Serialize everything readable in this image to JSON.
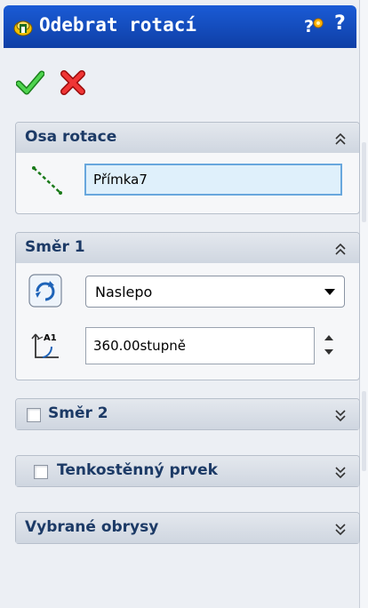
{
  "window": {
    "title": "Odebrat rotací",
    "help_label": "?"
  },
  "actions": {
    "ok": "confirm-check-icon",
    "cancel": "cancel-x-icon"
  },
  "axis_group": {
    "title": "Osa rotace",
    "entity_value": "Přímka7"
  },
  "direction1": {
    "title": "Směr 1",
    "end_condition": "Naslepo",
    "angle_value": "360.00stupně",
    "angle_icon_label": "A1"
  },
  "direction2": {
    "title": "Směr 2",
    "checked": false
  },
  "thin_feature": {
    "title": "Tenkostěnný prvek",
    "checked": false
  },
  "selected_contours": {
    "title": "Vybrané obrysy"
  },
  "colors": {
    "title_bar": "#1a5bd6",
    "header_text": "#1c3a66",
    "ok_green": "#2bb32b",
    "cancel_red": "#e02020"
  }
}
